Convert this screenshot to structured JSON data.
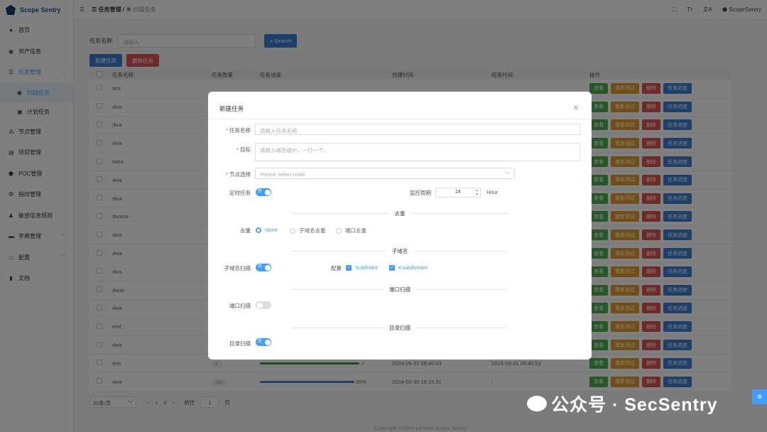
{
  "app": {
    "title": "Scope Sentry"
  },
  "sidebar": {
    "items": [
      {
        "label": "首页",
        "icon": "dashboard-icon"
      },
      {
        "label": "资产信息",
        "icon": "eye-icon"
      },
      {
        "label": "任务管理",
        "icon": "list-icon"
      },
      {
        "label": "扫描任务",
        "icon": "eye-icon"
      },
      {
        "label": "计划任务",
        "icon": "calendar-icon"
      },
      {
        "label": "节点管理",
        "icon": "node-icon"
      },
      {
        "label": "项目管理",
        "icon": "folder-icon"
      },
      {
        "label": "POC管理",
        "icon": "shield-icon"
      },
      {
        "label": "指纹管理",
        "icon": "fingerprint-icon"
      },
      {
        "label": "敏感信息规则",
        "icon": "user-icon"
      },
      {
        "label": "字典管理",
        "icon": "book-icon"
      },
      {
        "label": "配置",
        "icon": "monitor-icon"
      },
      {
        "label": "文档",
        "icon": "document-icon"
      }
    ]
  },
  "header": {
    "crumb1": "任务管理",
    "crumb2": "扫描任务",
    "user": "ScopeSentry"
  },
  "search": {
    "label": "任务名称:",
    "placeholder": "请输入",
    "button": "Search"
  },
  "actions": {
    "new": "新建任务",
    "delete": "删除任务"
  },
  "table": {
    "headers": [
      "任务名称",
      "任务数量",
      "任务进度",
      "创建时间",
      "结束时间",
      "操作"
    ],
    "ops": [
      "查看",
      "重新测试",
      "删除",
      "任务进度"
    ],
    "rows": [
      {
        "name": "test"
      },
      {
        "name": "dwa"
      },
      {
        "name": "dwa"
      },
      {
        "name": "dwa"
      },
      {
        "name": "twea"
      },
      {
        "name": "dwa"
      },
      {
        "name": "dwa"
      },
      {
        "name": "dwasw"
      },
      {
        "name": "dwa"
      },
      {
        "name": "dwa"
      },
      {
        "name": "dwa"
      },
      {
        "name": "dwas"
      },
      {
        "name": "dwa"
      },
      {
        "name": "end"
      },
      {
        "name": "dwa"
      },
      {
        "name": "test",
        "count": "2",
        "progress": "✓",
        "progress_value": 100,
        "created": "2024-05-31 09:40:43",
        "ended": "2024-05-31 09:40:53"
      },
      {
        "name": "dwa",
        "count": "185",
        "progress": "95%",
        "progress_value": 95,
        "created": "2024-05-30 19:15:31",
        "ended": "-"
      }
    ]
  },
  "pager": {
    "size": "20条/页",
    "pages": [
      "1",
      "2"
    ],
    "goto": "前往",
    "goto_val": "1",
    "unit": "页"
  },
  "footer": "Copyright ©2024-present Scope Sentry",
  "modal": {
    "title": "新建任务",
    "name_label": "任务名称",
    "name_ph": "请输入任务名称",
    "target_label": "目标",
    "target_ph": "请输入域名或IP，一行一个。",
    "node_label": "节点选择",
    "node_ph": "Please select node",
    "sched_label": "定时任务",
    "sched_on": "开",
    "cycle_label": "监控周期",
    "cycle_val": "24",
    "cycle_unit": "Hour",
    "dedup_title": "去重",
    "dedup_label": "去重",
    "dedup_opts": [
      "None",
      "子域名去重",
      "端口去重"
    ],
    "sub_title": "子域名",
    "sub_label": "子域名扫描",
    "cfg_label": "配置",
    "sub_opts": [
      "Subfinder",
      "Ksubdomain"
    ],
    "port_title": "端口扫描",
    "port_label": "端口扫描",
    "dir_title": "目录扫描",
    "dir_label": "目录扫描"
  },
  "watermark": "公众号 · SecSentry"
}
